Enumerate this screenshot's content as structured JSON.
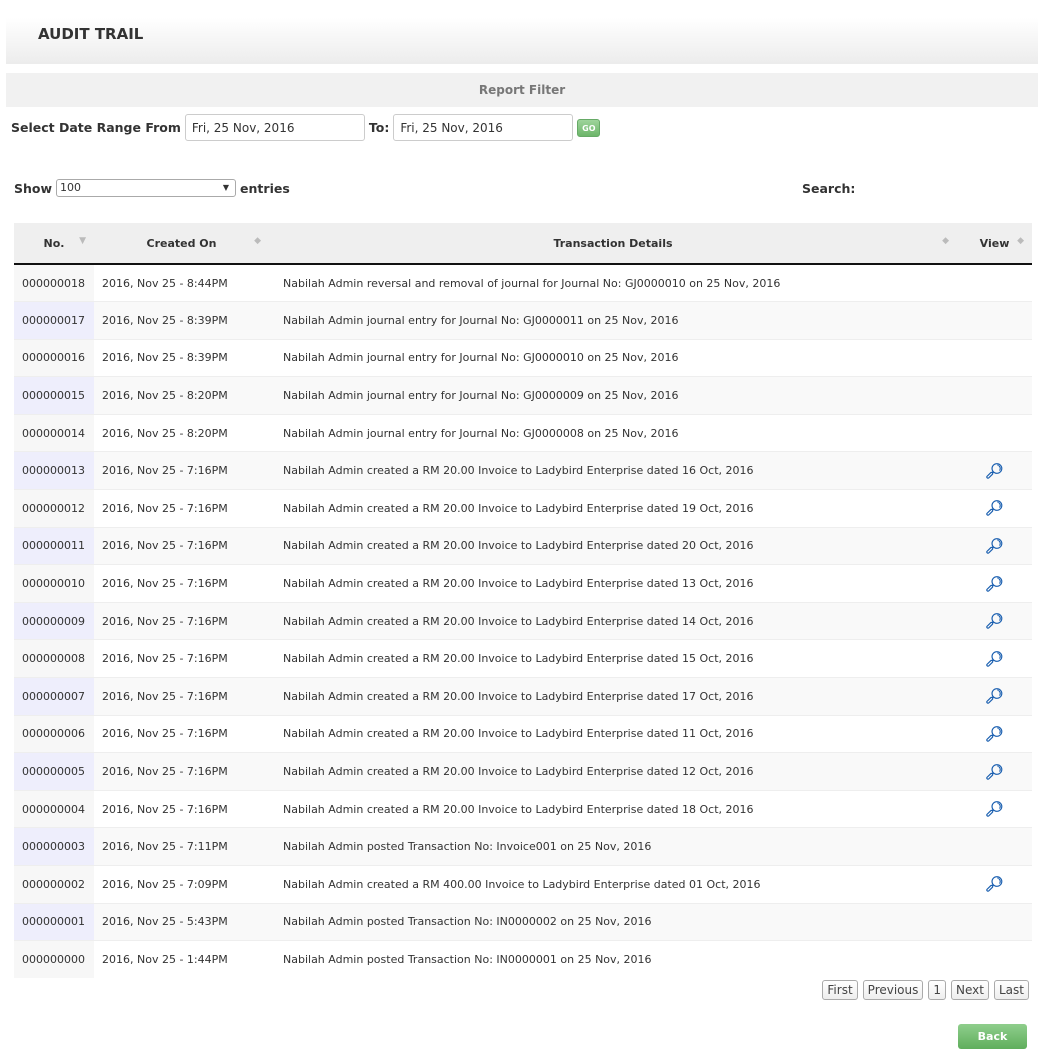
{
  "title": "AUDIT TRAIL",
  "filter": {
    "heading": "Report Filter",
    "from_label": "Select Date Range From",
    "from_value": "Fri, 25 Nov, 2016",
    "to_label": "To:",
    "to_value": "Fri, 25 Nov, 2016",
    "go": "GO"
  },
  "length": {
    "show": "Show",
    "value": "100",
    "entries": "entries"
  },
  "search_label": "Search:",
  "columns": [
    "No.",
    "Created On",
    "Transaction Details",
    "View"
  ],
  "rows": [
    [
      "000000018",
      "2016, Nov 25 - 8:44PM",
      "Nabilah Admin reversal and removal of journal for Journal No: GJ0000010 on 25 Nov, 2016",
      false
    ],
    [
      "000000017",
      "2016, Nov 25 - 8:39PM",
      "Nabilah Admin journal entry for Journal No: GJ0000011 on 25 Nov, 2016",
      false
    ],
    [
      "000000016",
      "2016, Nov 25 - 8:39PM",
      "Nabilah Admin journal entry for Journal No: GJ0000010 on 25 Nov, 2016",
      false
    ],
    [
      "000000015",
      "2016, Nov 25 - 8:20PM",
      "Nabilah Admin journal entry for Journal No: GJ0000009 on 25 Nov, 2016",
      false
    ],
    [
      "000000014",
      "2016, Nov 25 - 8:20PM",
      "Nabilah Admin journal entry for Journal No: GJ0000008 on 25 Nov, 2016",
      false
    ],
    [
      "000000013",
      "2016, Nov 25 - 7:16PM",
      "Nabilah Admin created a RM 20.00 Invoice to Ladybird Enterprise dated 16 Oct, 2016",
      true
    ],
    [
      "000000012",
      "2016, Nov 25 - 7:16PM",
      "Nabilah Admin created a RM 20.00 Invoice to Ladybird Enterprise dated 19 Oct, 2016",
      true
    ],
    [
      "000000011",
      "2016, Nov 25 - 7:16PM",
      "Nabilah Admin created a RM 20.00 Invoice to Ladybird Enterprise dated 20 Oct, 2016",
      true
    ],
    [
      "000000010",
      "2016, Nov 25 - 7:16PM",
      "Nabilah Admin created a RM 20.00 Invoice to Ladybird Enterprise dated 13 Oct, 2016",
      true
    ],
    [
      "000000009",
      "2016, Nov 25 - 7:16PM",
      "Nabilah Admin created a RM 20.00 Invoice to Ladybird Enterprise dated 14 Oct, 2016",
      true
    ],
    [
      "000000008",
      "2016, Nov 25 - 7:16PM",
      "Nabilah Admin created a RM 20.00 Invoice to Ladybird Enterprise dated 15 Oct, 2016",
      true
    ],
    [
      "000000007",
      "2016, Nov 25 - 7:16PM",
      "Nabilah Admin created a RM 20.00 Invoice to Ladybird Enterprise dated 17 Oct, 2016",
      true
    ],
    [
      "000000006",
      "2016, Nov 25 - 7:16PM",
      "Nabilah Admin created a RM 20.00 Invoice to Ladybird Enterprise dated 11 Oct, 2016",
      true
    ],
    [
      "000000005",
      "2016, Nov 25 - 7:16PM",
      "Nabilah Admin created a RM 20.00 Invoice to Ladybird Enterprise dated 12 Oct, 2016",
      true
    ],
    [
      "000000004",
      "2016, Nov 25 - 7:16PM",
      "Nabilah Admin created a RM 20.00 Invoice to Ladybird Enterprise dated 18 Oct, 2016",
      true
    ],
    [
      "000000003",
      "2016, Nov 25 - 7:11PM",
      "Nabilah Admin posted Transaction No: Invoice001 on 25 Nov, 2016",
      false
    ],
    [
      "000000002",
      "2016, Nov 25 - 7:09PM",
      "Nabilah Admin created a RM 400.00 Invoice to Ladybird Enterprise dated 01 Oct, 2016",
      true
    ],
    [
      "000000001",
      "2016, Nov 25 - 5:43PM",
      "Nabilah Admin posted Transaction No: IN0000002 on 25 Nov, 2016",
      false
    ],
    [
      "000000000",
      "2016, Nov 25 - 1:44PM",
      "Nabilah Admin posted Transaction No: IN0000001 on 25 Nov, 2016",
      false
    ]
  ],
  "pager": [
    "First",
    "Previous",
    "1",
    "Next",
    "Last"
  ],
  "back": "Back"
}
